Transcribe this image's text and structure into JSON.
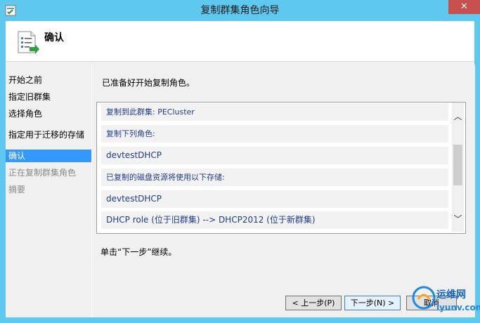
{
  "window": {
    "title": "复制群集角色向导",
    "close_label": "✕"
  },
  "header": {
    "title": "确认"
  },
  "sidebar": {
    "items": [
      {
        "label": "开始之前",
        "state": "normal"
      },
      {
        "label": "指定旧群集",
        "state": "normal"
      },
      {
        "label": "选择角色",
        "state": "normal"
      },
      {
        "label": "指定用于迁移的存储",
        "state": "normal"
      },
      {
        "label": "确认",
        "state": "active"
      },
      {
        "label": "正在复制群集角色",
        "state": "disabled"
      },
      {
        "label": "摘要",
        "state": "disabled"
      }
    ]
  },
  "main": {
    "intro": "已准备好开始复制角色。",
    "rows": [
      "复制到此群集: PECluster",
      "复制下列角色:",
      "devtestDHCP",
      "已复制的磁盘资源将使用以下存储:",
      "devtestDHCP",
      "DHCP role (位于旧群集) --> DHCP2012 (位于新群集)"
    ],
    "next_hint": "单击“下一步”继续。"
  },
  "buttons": {
    "prev": "< 上一步(P)",
    "next": "下一步(N) >",
    "cancel": "取消"
  },
  "watermark": {
    "line1": "运维网",
    "line2": "iyunv.com"
  },
  "colors": {
    "titlebar": "#5fc8ee",
    "active_nav": "#3399ff",
    "row_text": "#1f3d8a",
    "close": "#c7504e"
  }
}
